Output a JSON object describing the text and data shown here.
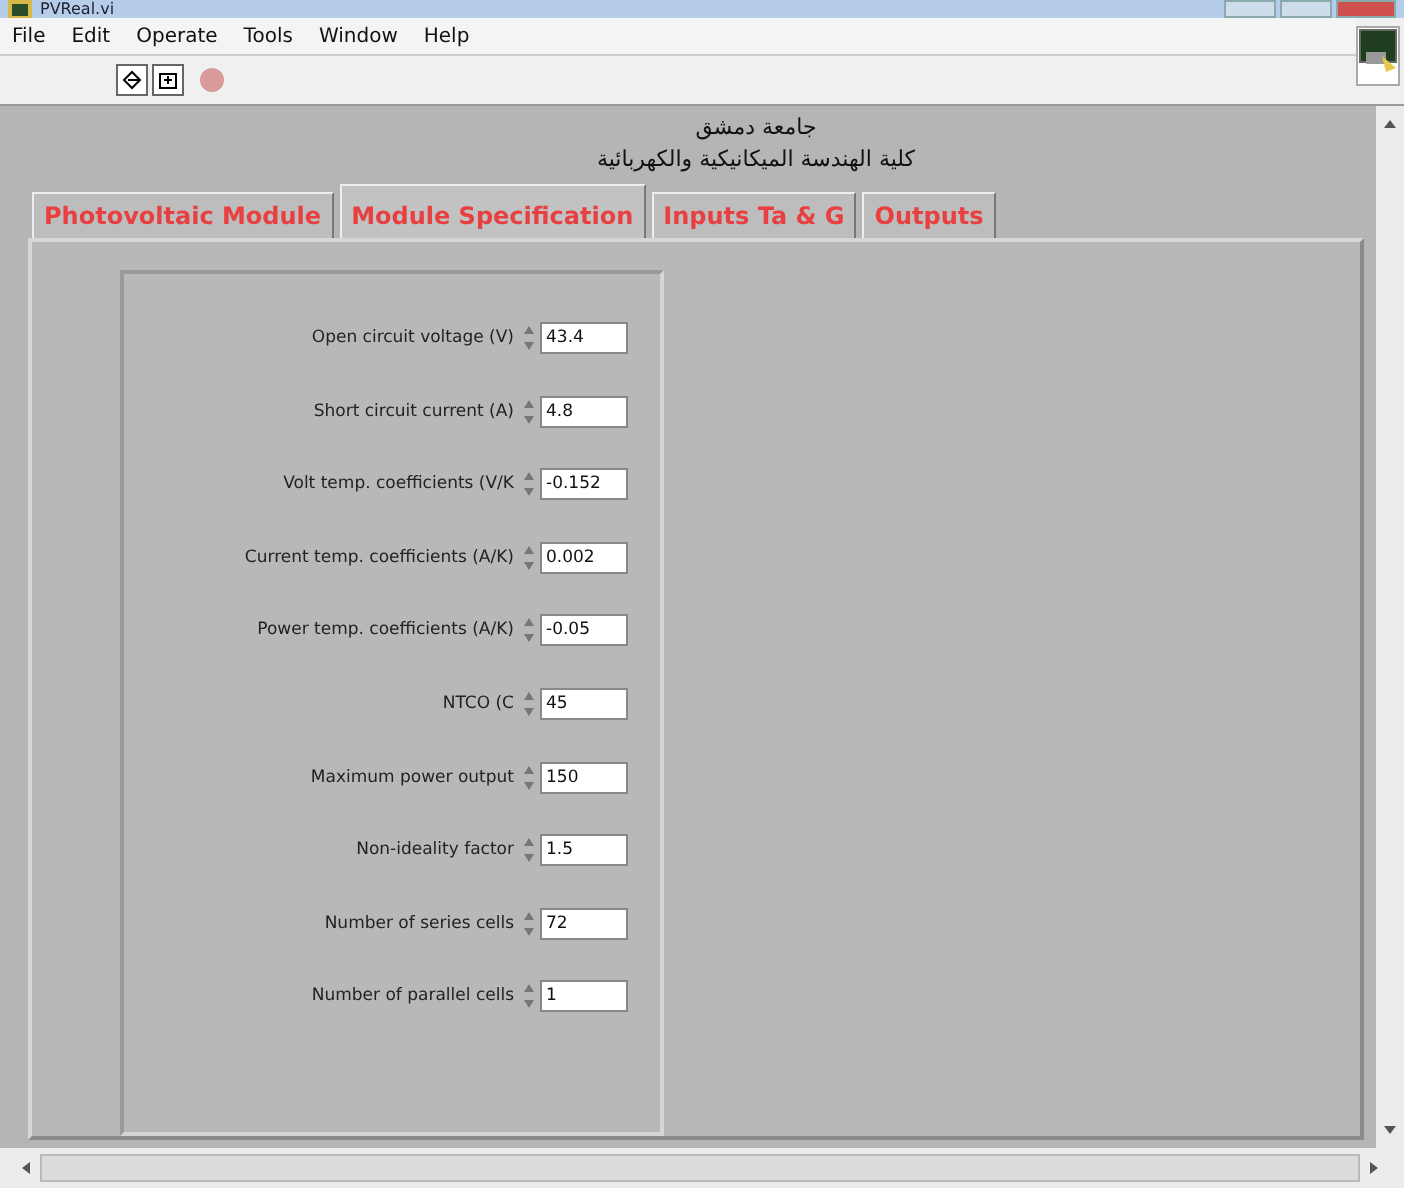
{
  "window": {
    "title": "PVReal.vi"
  },
  "menu": [
    "File",
    "Edit",
    "Operate",
    "Tools",
    "Window",
    "Help"
  ],
  "header": [
    "جامعة دمشق",
    "كلية الهندسة الميكانيكية والكهربائية"
  ],
  "tabs": [
    {
      "label": "Photovoltaic Module",
      "selected": false
    },
    {
      "label": "Module Specification",
      "selected": true
    },
    {
      "label": "Inputs Ta & G",
      "selected": false
    },
    {
      "label": "Outputs",
      "selected": false
    }
  ],
  "fields": [
    {
      "label": "Open circuit voltage (V)",
      "value": "43.4"
    },
    {
      "label": "Short circuit current (A)",
      "value": "4.8"
    },
    {
      "label": "Volt temp. coefficients (V/K",
      "value": "-0.152"
    },
    {
      "label": "Current temp. coefficients (A/K)",
      "value": "0.002"
    },
    {
      "label": "Power temp. coefficients (A/K)",
      "value": "-0.05"
    },
    {
      "label": "NTCO (C",
      "value": "45"
    },
    {
      "label": "Maximum power output",
      "value": "150"
    },
    {
      "label": "Non-ideality factor",
      "value": "1.5"
    },
    {
      "label": "Number of series cells",
      "value": "72"
    },
    {
      "label": "Number of parallel cells",
      "value": "1"
    }
  ]
}
